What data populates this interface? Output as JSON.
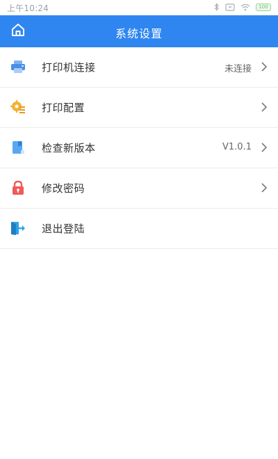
{
  "status_bar": {
    "time": "上午10:24",
    "battery": "100"
  },
  "header": {
    "title": "系统设置",
    "home_icon": "home-icon"
  },
  "menu": {
    "items": [
      {
        "label": "打印机连接",
        "value": "未连接",
        "icon": "printer-icon",
        "color": "#4a8fe7"
      },
      {
        "label": "打印配置",
        "value": "",
        "icon": "gear-list-icon",
        "color": "#f2b233"
      },
      {
        "label": "检查新版本",
        "value": "V1.0.1",
        "icon": "bookmark-icon",
        "color": "#5aa7f0"
      },
      {
        "label": "修改密码",
        "value": "",
        "icon": "lock-icon",
        "color": "#f05a5a"
      },
      {
        "label": "退出登陆",
        "value": "",
        "icon": "logout-icon",
        "color": "#32a2e8"
      }
    ]
  },
  "colors": {
    "header_bg": "#2f86f0",
    "divider": "#ececec"
  }
}
